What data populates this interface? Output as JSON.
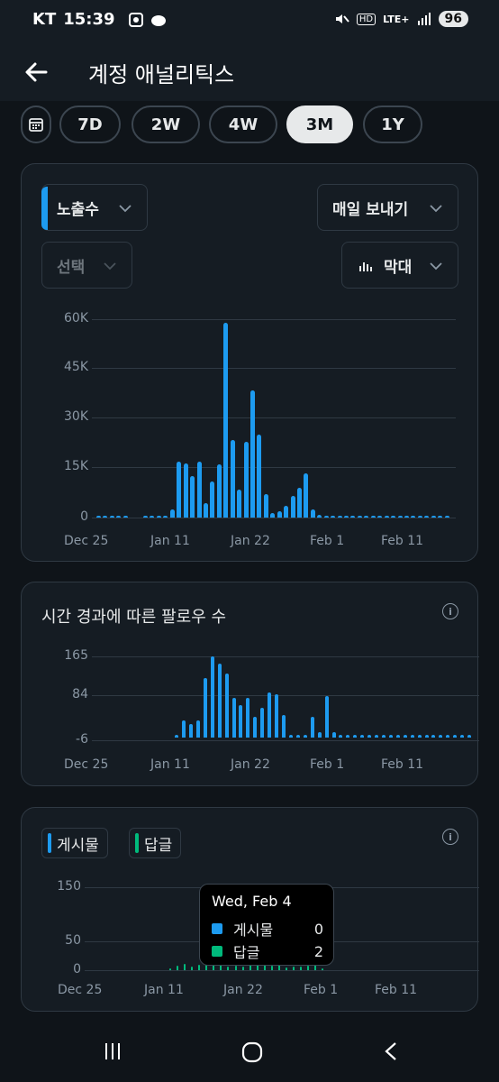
{
  "status": {
    "carrier": "KT",
    "time": "15:39",
    "net": "LTE+",
    "hd": "HD",
    "battery": "96"
  },
  "header": {
    "title": "계정 애널리틱스"
  },
  "ranges": [
    {
      "label": "7D",
      "active": false
    },
    {
      "label": "2W",
      "active": false
    },
    {
      "label": "4W",
      "active": false
    },
    {
      "label": "3M",
      "active": true
    },
    {
      "label": "1Y",
      "active": false
    }
  ],
  "impressions_card": {
    "metric_select": "노출수",
    "frequency_select": "매일 보내기",
    "compare_select": "선택",
    "chart_type_select": "막대"
  },
  "followers_card": {
    "title": "시간 경과에 따른 팔로우 수"
  },
  "posts_card": {
    "legend": [
      {
        "label": "게시물",
        "color": "#1d9bf0"
      },
      {
        "label": "답글",
        "color": "#00ba7c"
      }
    ],
    "tooltip": {
      "date": "Wed, Feb 4",
      "rows": [
        {
          "label": "게시물",
          "value": "0",
          "color": "#1d9bf0"
        },
        {
          "label": "답글",
          "value": "2",
          "color": "#00ba7c"
        }
      ]
    }
  },
  "chart_data": [
    {
      "type": "bar",
      "x_tick_labels": [
        "Dec 25",
        "Jan 11",
        "Jan 22",
        "Feb 1",
        "Feb 11"
      ],
      "y_tick_labels": [
        "60K",
        "45K",
        "30K",
        "15K",
        "0"
      ],
      "ylim": [
        0,
        60000
      ],
      "series": [
        {
          "values": [
            50,
            50,
            50,
            50,
            50,
            0,
            0,
            50,
            50,
            50,
            50,
            2500,
            17000,
            16500,
            12500,
            16800,
            4500,
            11000,
            16000,
            59000,
            23500,
            8500,
            23000,
            38500,
            25000,
            7000,
            1500,
            2000,
            3500,
            6500,
            9000,
            13500,
            2500,
            800,
            600,
            500,
            400,
            300,
            500,
            400,
            300,
            200,
            200,
            200,
            200,
            200,
            200,
            200,
            200,
            200,
            200,
            200,
            200
          ]
        }
      ],
      "grid": true
    },
    {
      "type": "bar",
      "x_tick_labels": [
        "Dec 25",
        "Jan 11",
        "Jan 22",
        "Feb 1",
        "Feb 11"
      ],
      "y_tick_labels": [
        "165",
        "84",
        "-6"
      ],
      "ylim": [
        -6,
        165
      ],
      "series": [
        {
          "values": [
            0,
            0,
            0,
            0,
            0,
            0,
            0,
            0,
            0,
            0,
            0,
            5,
            35,
            28,
            35,
            120,
            165,
            150,
            130,
            80,
            65,
            80,
            42,
            60,
            92,
            88,
            45,
            5,
            5,
            5,
            42,
            10,
            85,
            10,
            5,
            5,
            5,
            5,
            5,
            5,
            5,
            5,
            5,
            5,
            5,
            5,
            5,
            5,
            5,
            5,
            5,
            5,
            5
          ]
        }
      ],
      "grid": true
    },
    {
      "type": "bar",
      "x_tick_labels": [
        "Dec 25",
        "Jan 11",
        "Jan 22",
        "Feb 1",
        "Feb 11"
      ],
      "y_tick_labels": [
        "150",
        "50",
        "0"
      ],
      "ylim": [
        0,
        150
      ],
      "series": [
        {
          "name": "게시물",
          "values": [
            0,
            0,
            0,
            0,
            0,
            0,
            0,
            0,
            0,
            0,
            0,
            0,
            0,
            0,
            0,
            0,
            0,
            0,
            0,
            0,
            0,
            0,
            0,
            0,
            0,
            0,
            0,
            0,
            0,
            0,
            0,
            0,
            0,
            0,
            0,
            0,
            0,
            0,
            0,
            0,
            0,
            0,
            0,
            0,
            0,
            0,
            0,
            0,
            0,
            0,
            0,
            0,
            0
          ]
        },
        {
          "name": "답글",
          "values": [
            0,
            0,
            0,
            0,
            0,
            0,
            0,
            0,
            0,
            0,
            0,
            3,
            8,
            12,
            6,
            10,
            14,
            9,
            10,
            7,
            8,
            6,
            10,
            12,
            9,
            8,
            9,
            5,
            7,
            6,
            8,
            12,
            2,
            0,
            0,
            0,
            0,
            0,
            0,
            0,
            0,
            0,
            0,
            0,
            0,
            0,
            0,
            0,
            0,
            0,
            0,
            0,
            0
          ]
        }
      ],
      "grid": true
    }
  ]
}
